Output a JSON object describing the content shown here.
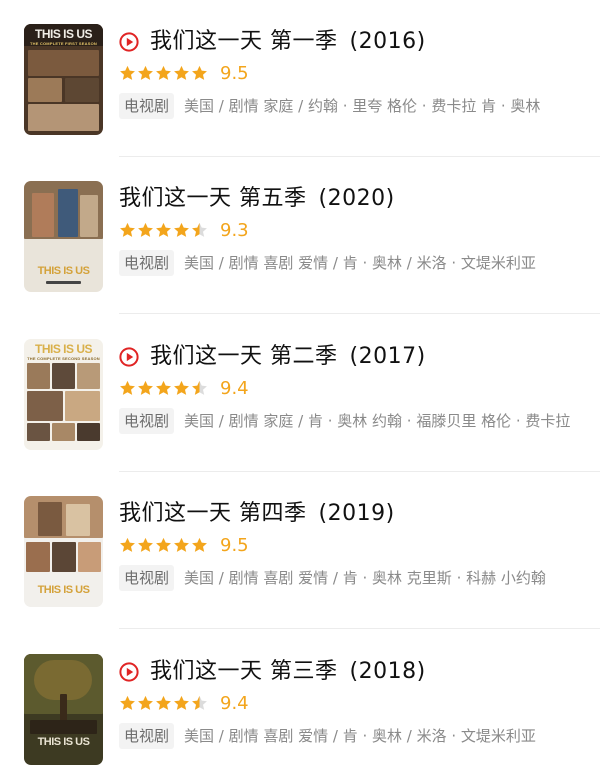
{
  "colors": {
    "star": "#f3a51c",
    "play": "#e02424",
    "tag_bg": "#f3f3f3",
    "meta_text": "#8a8a8a"
  },
  "items": [
    {
      "title": "我们这一天 第一季",
      "year": "(2016)",
      "has_play_icon": true,
      "stars": 5,
      "rating": "9.5",
      "type": "电视剧",
      "meta": "美国 / 剧情 家庭 / 约翰 · 里夸 格伦 · 费卡拉 肯 · 奥林",
      "poster": {
        "logo": "THIS IS US",
        "subtitle": "THE COMPLETE FIRST SEASON"
      }
    },
    {
      "title": "我们这一天 第五季",
      "year": "(2020)",
      "has_play_icon": false,
      "stars": 4.5,
      "rating": "9.3",
      "type": "电视剧",
      "meta": "美国 / 剧情 喜剧 爱情 / 肯 · 奥林 / 米洛 · 文堤米利亚",
      "poster": {
        "logo": "THIS IS US",
        "subtitle": ""
      }
    },
    {
      "title": "我们这一天 第二季",
      "year": "(2017)",
      "has_play_icon": true,
      "stars": 4.5,
      "rating": "9.4",
      "type": "电视剧",
      "meta": "美国 / 剧情 家庭 / 肯 · 奥林 约翰 · 福滕贝里 格伦 · 费卡拉",
      "poster": {
        "logo": "THIS IS US",
        "subtitle": "THE COMPLETE SECOND SEASON"
      }
    },
    {
      "title": "我们这一天 第四季",
      "year": "(2019)",
      "has_play_icon": false,
      "stars": 5,
      "rating": "9.5",
      "type": "电视剧",
      "meta": "美国 / 剧情 喜剧 爱情 / 肯 · 奥林 克里斯 · 科赫 小约翰",
      "poster": {
        "logo": "THIS IS US",
        "subtitle": ""
      }
    },
    {
      "title": "我们这一天 第三季",
      "year": "(2018)",
      "has_play_icon": true,
      "stars": 4.5,
      "rating": "9.4",
      "type": "电视剧",
      "meta": "美国 / 剧情 喜剧 爱情 / 肯 · 奥林 / 米洛 · 文堤米利亚",
      "poster": {
        "logo": "THIS IS US",
        "subtitle": ""
      }
    }
  ]
}
